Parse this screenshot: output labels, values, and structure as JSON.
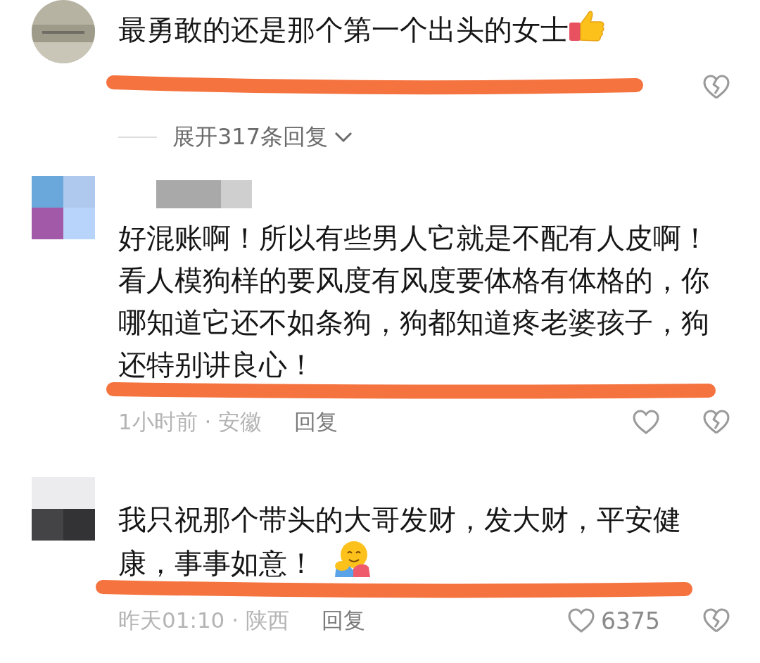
{
  "comments": [
    {
      "avatar": {
        "kind": "round"
      },
      "text": "最勇敢的还是那个第一个出头的女士",
      "emoji": {
        "kind": "thumbs-up"
      },
      "expand": "展开317条回复"
    },
    {
      "avatar": {
        "kind": "tiles-color"
      },
      "text": "好混账啊！所以有些男人它就是不配有人皮啊！看人模狗样的要风度有风度要体格有体格的，你哪知道它还不如条狗，狗都知道疼老婆孩子，狗还特别讲良心！",
      "meta": "1小时前 · 安徽",
      "reply": "回复"
    },
    {
      "avatar": {
        "kind": "tiles-dark"
      },
      "text": "我只祝那个带头的大哥发财，发大财，平安健康，事事如意！",
      "emoji": {
        "kind": "hug"
      },
      "meta": "昨天01:10 · 陕西",
      "reply": "回复",
      "likes": "6375"
    }
  ]
}
